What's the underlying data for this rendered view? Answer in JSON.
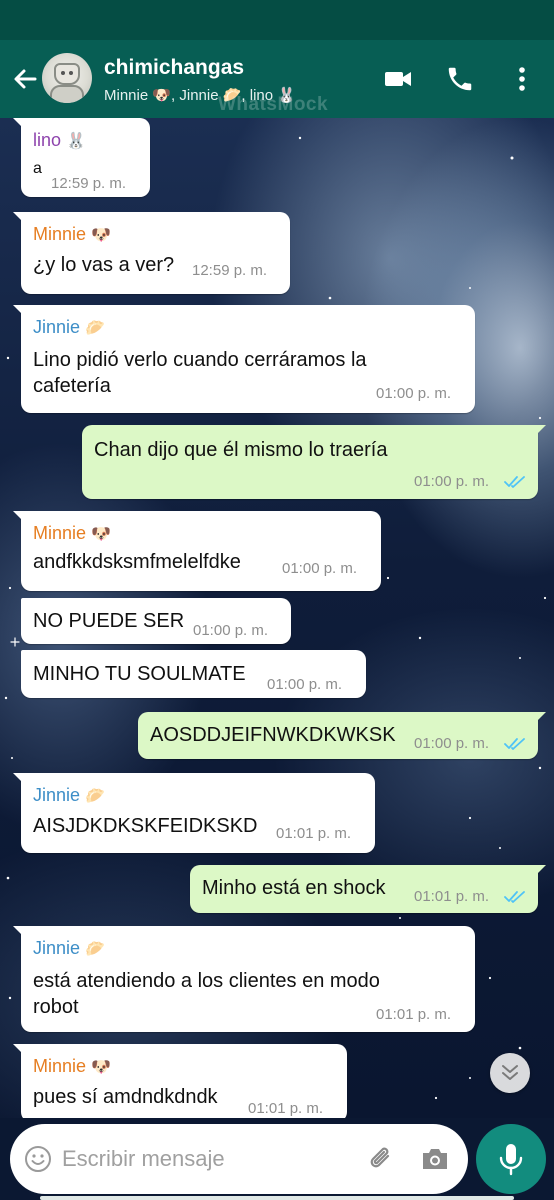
{
  "header": {
    "title": "chimichangas",
    "subtitle": "Minnie 🐶, Jinnie 🥟, lino 🐰",
    "watermark": "WhatsMock"
  },
  "colors": {
    "header": "#075e54",
    "status_bar": "#054d44",
    "incoming_bubble": "#ffffff",
    "outgoing_bubble": "#dcf8c6",
    "sender_lino": "#8e44ad",
    "sender_minnie": "#e67e22",
    "sender_jinnie": "#3d8ec7",
    "read_ticks": "#4fc3f7",
    "mic_button": "#128c7e"
  },
  "messages": [
    {
      "dir": "in",
      "sender": "lino",
      "emoji": "🐰",
      "text": "a",
      "time": "12:59 p. m."
    },
    {
      "dir": "in",
      "sender": "Minnie",
      "emoji": "🐶",
      "text": "¿y lo vas a ver?",
      "time": "12:59 p. m."
    },
    {
      "dir": "in",
      "sender": "Jinnie",
      "emoji": "🥟",
      "text_lines": [
        "Lino pidió verlo cuando cerráramos la",
        "cafetería"
      ],
      "time": "01:00 p. m."
    },
    {
      "dir": "out",
      "text": "Chan dijo que él mismo lo traería",
      "time": "01:00 p. m.",
      "status": "read"
    },
    {
      "dir": "in",
      "sender": "Minnie",
      "emoji": "🐶",
      "text": "andfkkdsksmfmelelfdke",
      "time": "01:00 p. m."
    },
    {
      "dir": "in",
      "text": "NO PUEDE SER",
      "time": "01:00 p. m."
    },
    {
      "dir": "in",
      "text": "MINHO TU SOULMATE",
      "time": "01:00 p. m."
    },
    {
      "dir": "out",
      "text": "AOSDDJEIFNWKDKWKSK",
      "time": "01:00 p. m.",
      "status": "read"
    },
    {
      "dir": "in",
      "sender": "Jinnie",
      "emoji": "🥟",
      "text": "AISJDKDKSKFEIDKSKD",
      "time": "01:01 p. m."
    },
    {
      "dir": "out",
      "text": "Minho está en shock",
      "time": "01:01 p. m.",
      "status": "read"
    },
    {
      "dir": "in",
      "sender": "Jinnie",
      "emoji": "🥟",
      "text_lines": [
        "está atendiendo a los clientes en modo",
        "robot"
      ],
      "time": "01:01 p. m."
    },
    {
      "dir": "in",
      "sender": "Minnie",
      "emoji": "🐶",
      "text": "pues sí amdndkdndk",
      "time": "01:01 p. m."
    }
  ],
  "composer": {
    "placeholder": "Escribir mensaje"
  },
  "icons": {
    "back": "arrow-left-icon",
    "video": "video-camera-icon",
    "call": "phone-icon",
    "menu": "more-vertical-icon",
    "emoji": "emoji-icon",
    "attach": "paperclip-icon",
    "camera": "camera-icon",
    "mic": "microphone-icon",
    "scroll": "chevron-double-down-icon"
  }
}
